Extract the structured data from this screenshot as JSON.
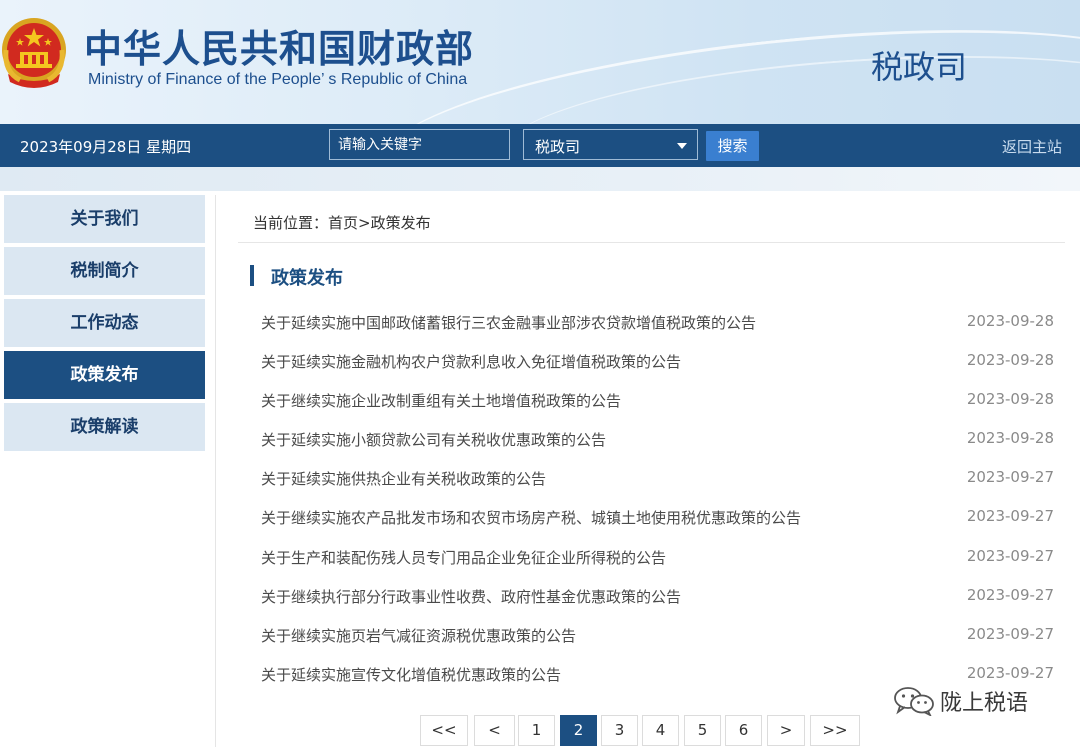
{
  "header": {
    "title_cn": "中华人民共和国财政部",
    "title_en": "Ministry of Finance of the People’ s Republic of China",
    "department": "税政司",
    "emblem_icon": "national-emblem-icon"
  },
  "navbar": {
    "date": "2023年09月28日  星期四",
    "search_placeholder": "请输入关键字",
    "select_value": "税政司",
    "search_button": "搜索",
    "back_home": "返回主站"
  },
  "sidebar": {
    "items": [
      {
        "label": "关于我们",
        "active": false
      },
      {
        "label": "税制简介",
        "active": false
      },
      {
        "label": "工作动态",
        "active": false
      },
      {
        "label": "政策发布",
        "active": true
      },
      {
        "label": "政策解读",
        "active": false
      }
    ]
  },
  "main": {
    "breadcrumb": "当前位置：首页>政策发布",
    "section_title": "政策发布",
    "articles": [
      {
        "title": "关于延续实施中国邮政储蓄银行三农金融事业部涉农贷款增值税政策的公告",
        "date": "2023-09-28"
      },
      {
        "title": "关于延续实施金融机构农户贷款利息收入免征增值税政策的公告",
        "date": "2023-09-28"
      },
      {
        "title": "关于继续实施企业改制重组有关土地增值税政策的公告",
        "date": "2023-09-28"
      },
      {
        "title": "关于延续实施小额贷款公司有关税收优惠政策的公告",
        "date": "2023-09-28"
      },
      {
        "title": "关于延续实施供热企业有关税收政策的公告",
        "date": "2023-09-27"
      },
      {
        "title": "关于继续实施农产品批发市场和农贸市场房产税、城镇土地使用税优惠政策的公告",
        "date": "2023-09-27"
      },
      {
        "title": "关于生产和装配伤残人员专门用品企业免征企业所得税的公告",
        "date": "2023-09-27"
      },
      {
        "title": "关于继续执行部分行政事业性收费、政府性基金优惠政策的公告",
        "date": "2023-09-27"
      },
      {
        "title": "关于继续实施页岩气减征资源税优惠政策的公告",
        "date": "2023-09-27"
      },
      {
        "title": "关于延续实施宣传文化增值税优惠政策的公告",
        "date": "2023-09-27"
      }
    ]
  },
  "pagination": {
    "first": "<<",
    "prev": "<",
    "pages": [
      "1",
      "2",
      "3",
      "4",
      "5",
      "6"
    ],
    "current": "2",
    "next": ">",
    "last": ">>"
  },
  "watermark": {
    "text": "陇上税语",
    "icon": "wechat-icon"
  },
  "colors": {
    "brand_blue": "#1c4f82",
    "title_blue": "#1d4f8e",
    "search_button": "#3a7fd0",
    "sidebar_bg": "#dbe7f2"
  }
}
